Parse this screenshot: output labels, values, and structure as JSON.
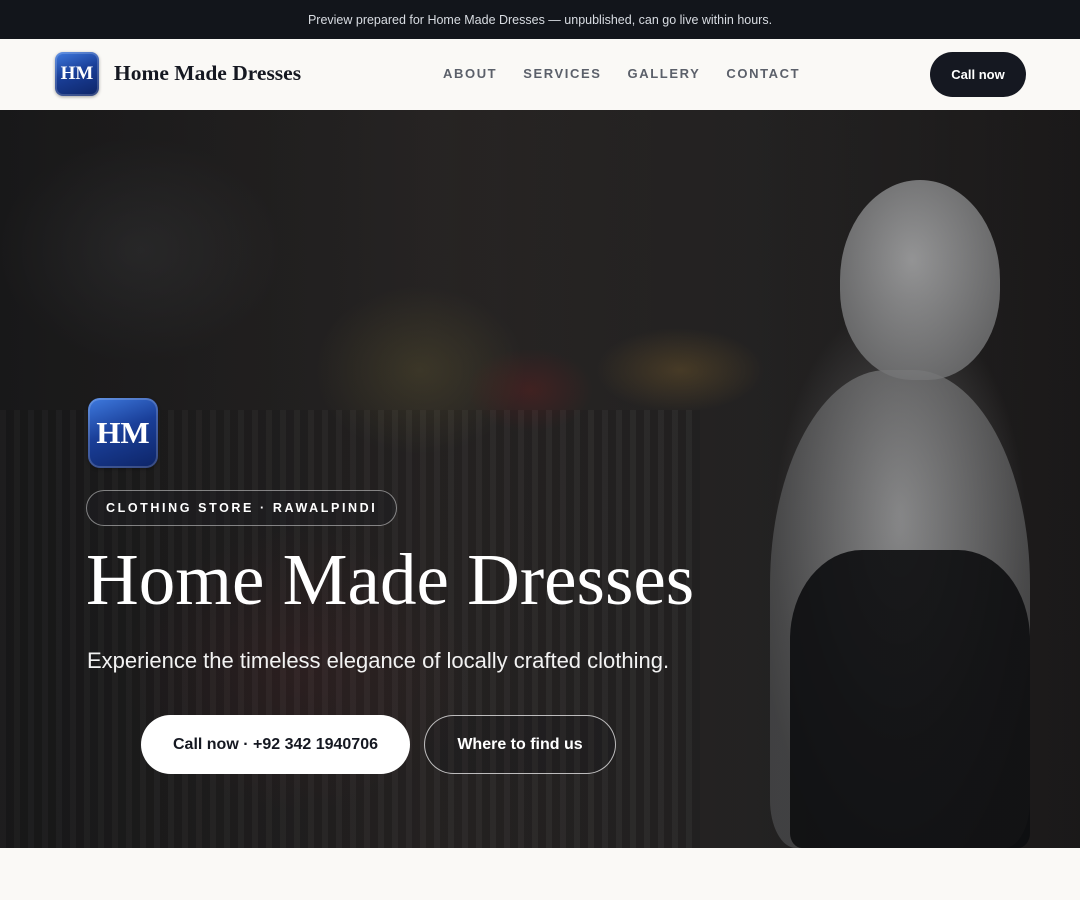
{
  "banner": {
    "text": "Preview prepared for Home Made Dresses — unpublished, can go live within hours."
  },
  "nav": {
    "logo_text": "HM",
    "brand": "Home Made Dresses",
    "links": [
      "ABOUT",
      "SERVICES",
      "GALLERY",
      "CONTACT"
    ],
    "cta": "Call now"
  },
  "hero": {
    "logo_text": "HM",
    "category": "CLOTHING STORE · RAWALPINDI",
    "title": "Home Made Dresses",
    "tagline": "Experience the timeless elegance of locally crafted clothing.",
    "primary_button": "Call now · +92 342 1940706",
    "secondary_button": "Where to find us"
  },
  "colors": {
    "dark": "#151821",
    "banner_bg": "#12151b",
    "page_bg": "#faf9f6",
    "logo_blue": "#1a3f99"
  }
}
